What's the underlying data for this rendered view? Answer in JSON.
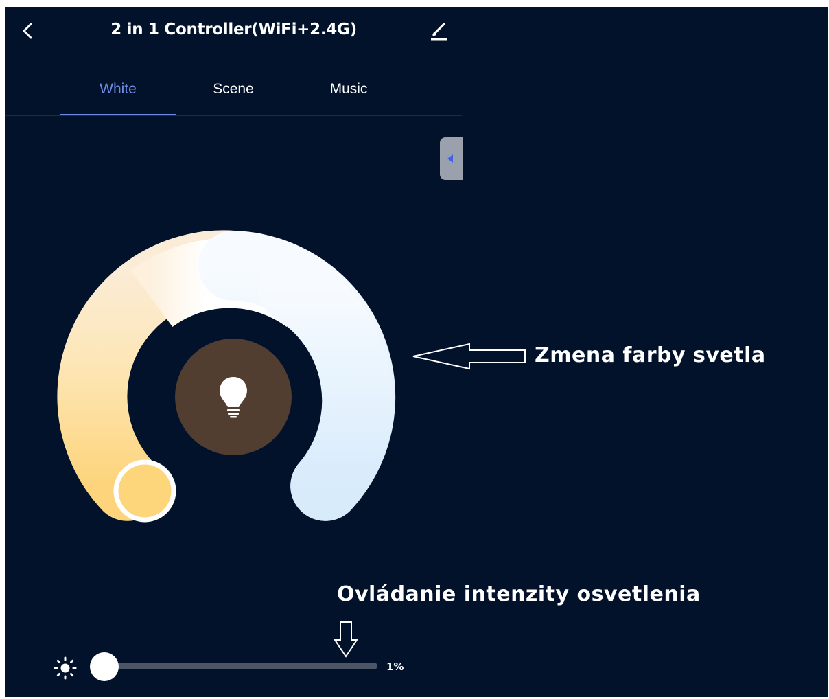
{
  "header": {
    "title": "2 in 1 Controller(WiFi+2.4G)",
    "back_icon": "chevron-left-icon",
    "edit_icon": "pencil-icon"
  },
  "tabs": [
    {
      "label": "White",
      "active": true
    },
    {
      "label": "Scene",
      "active": false
    },
    {
      "label": "Music",
      "active": false
    }
  ],
  "dial": {
    "center_icon": "lightbulb-icon",
    "warm_color": "#fdd57e",
    "cool_color": "#d9ecfb",
    "center_color": "#523d31"
  },
  "annotations": {
    "color_change": "Zmena farby svetla",
    "intensity_control": "Ovládanie intenzity osvetlenia"
  },
  "brightness": {
    "icon": "sun-icon",
    "value_label": "1%",
    "value": 0.01
  },
  "colors": {
    "background": "#03122b",
    "accent": "#6b8be3",
    "track": "#4c5566"
  }
}
